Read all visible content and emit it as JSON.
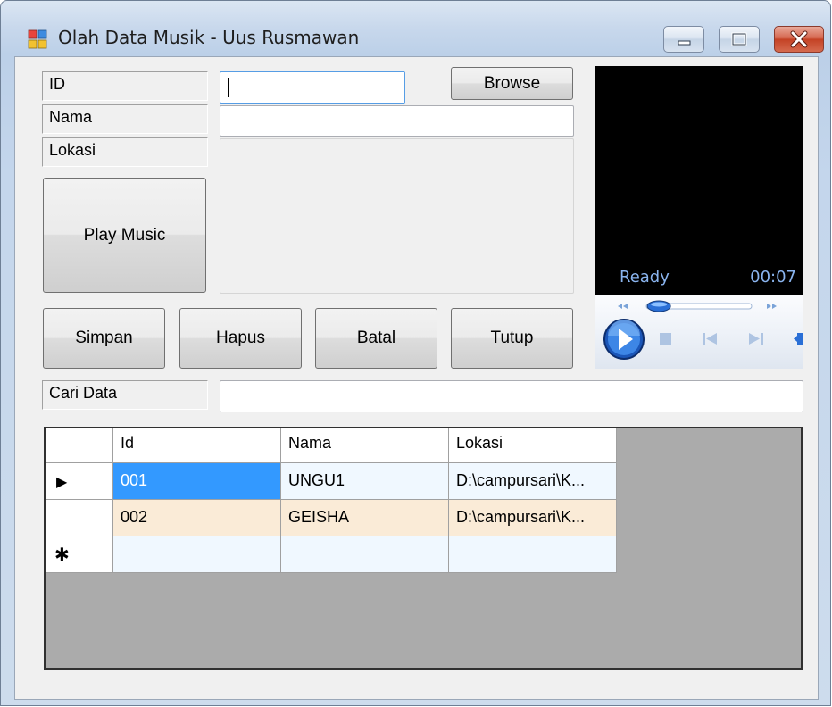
{
  "window": {
    "title": "Olah Data Musik - Uus Rusmawan"
  },
  "form": {
    "id_label": "ID",
    "nama_label": "Nama",
    "lokasi_label": "Lokasi",
    "cari_label": "Cari Data",
    "id_value": "",
    "nama_value": "",
    "lokasi_value": "",
    "cari_value": ""
  },
  "buttons": {
    "browse": "Browse",
    "play_music": "Play Music",
    "simpan": "Simpan",
    "hapus": "Hapus",
    "batal": "Batal",
    "tutup": "Tutup"
  },
  "player": {
    "status": "Ready",
    "time": "00:07",
    "icons": [
      "play-icon",
      "stop-icon",
      "previous-icon",
      "next-icon",
      "volume-icon",
      "rewind-icon",
      "fast-forward-icon"
    ],
    "seek_position": 0.12
  },
  "grid": {
    "columns": [
      "Id",
      "Nama",
      "Lokasi"
    ],
    "rows": [
      {
        "id": "001",
        "nama": "UNGU1",
        "lokasi": "D:\\campursari\\K..."
      },
      {
        "id": "002",
        "nama": "GEISHA",
        "lokasi": "D:\\campursari\\K..."
      }
    ],
    "current_row_marker": "▶",
    "new_row_marker": "✱"
  },
  "colors": {
    "selection": "#3399ff",
    "alt_row": "#faebd7",
    "row": "#f0f8ff",
    "grid_background": "#ababab",
    "player_text": "#8ab4ee",
    "close_button": "#c44225"
  }
}
